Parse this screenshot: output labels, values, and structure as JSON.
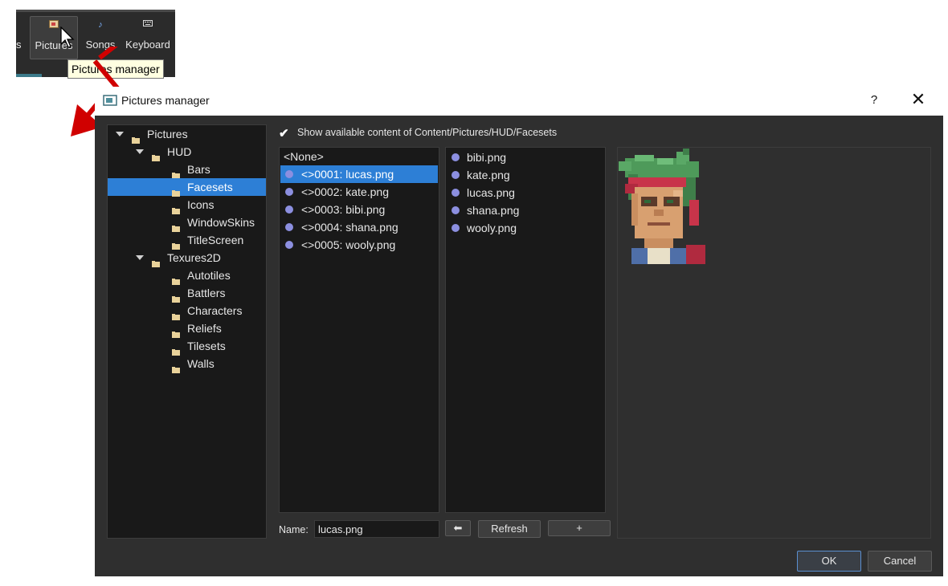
{
  "toolbar": {
    "prev_label": "s",
    "pictures_label": "Pictures",
    "songs_label": "Songs",
    "keyboard_label": "Keyboard",
    "tooltip": "Pictures manager"
  },
  "dialog": {
    "title": "Pictures manager",
    "help": "?",
    "close": "✕"
  },
  "tree": [
    {
      "label": "Pictures",
      "level": 0,
      "expanded": true
    },
    {
      "label": "HUD",
      "level": 1,
      "expanded": true
    },
    {
      "label": "Bars",
      "level": 2
    },
    {
      "label": "Facesets",
      "level": 2,
      "selected": true
    },
    {
      "label": "Icons",
      "level": 2
    },
    {
      "label": "WindowSkins",
      "level": 2
    },
    {
      "label": "TitleScreen",
      "level": 2
    },
    {
      "label": "Texures2D",
      "level": 1,
      "expanded": true
    },
    {
      "label": "Autotiles",
      "level": 2
    },
    {
      "label": "Battlers",
      "level": 2
    },
    {
      "label": "Characters",
      "level": 2
    },
    {
      "label": "Reliefs",
      "level": 2
    },
    {
      "label": "Tilesets",
      "level": 2
    },
    {
      "label": "Walls",
      "level": 2
    }
  ],
  "show_available": {
    "checked": true,
    "mark": "✔",
    "label": "Show available content of Content/Pictures/HUD/Facesets"
  },
  "project_list": [
    {
      "label": "<None>",
      "dot": false
    },
    {
      "label": "<>0001: lucas.png",
      "dot": true,
      "selected": true
    },
    {
      "label": "<>0002: kate.png",
      "dot": true
    },
    {
      "label": "<>0003: bibi.png",
      "dot": true
    },
    {
      "label": "<>0004: shana.png",
      "dot": true
    },
    {
      "label": "<>0005: wooly.png",
      "dot": true
    }
  ],
  "content_list": [
    "bibi.png",
    "kate.png",
    "lucas.png",
    "shana.png",
    "wooly.png"
  ],
  "name_field": {
    "label": "Name:",
    "value": "lucas.png"
  },
  "buttons": {
    "move": "⬅",
    "refresh": "Refresh",
    "add": "+",
    "ok": "OK",
    "cancel": "Cancel"
  },
  "colors": {
    "selection": "#2d7fd6",
    "dot": "#8c8fe0",
    "arrow": "#d00000"
  }
}
